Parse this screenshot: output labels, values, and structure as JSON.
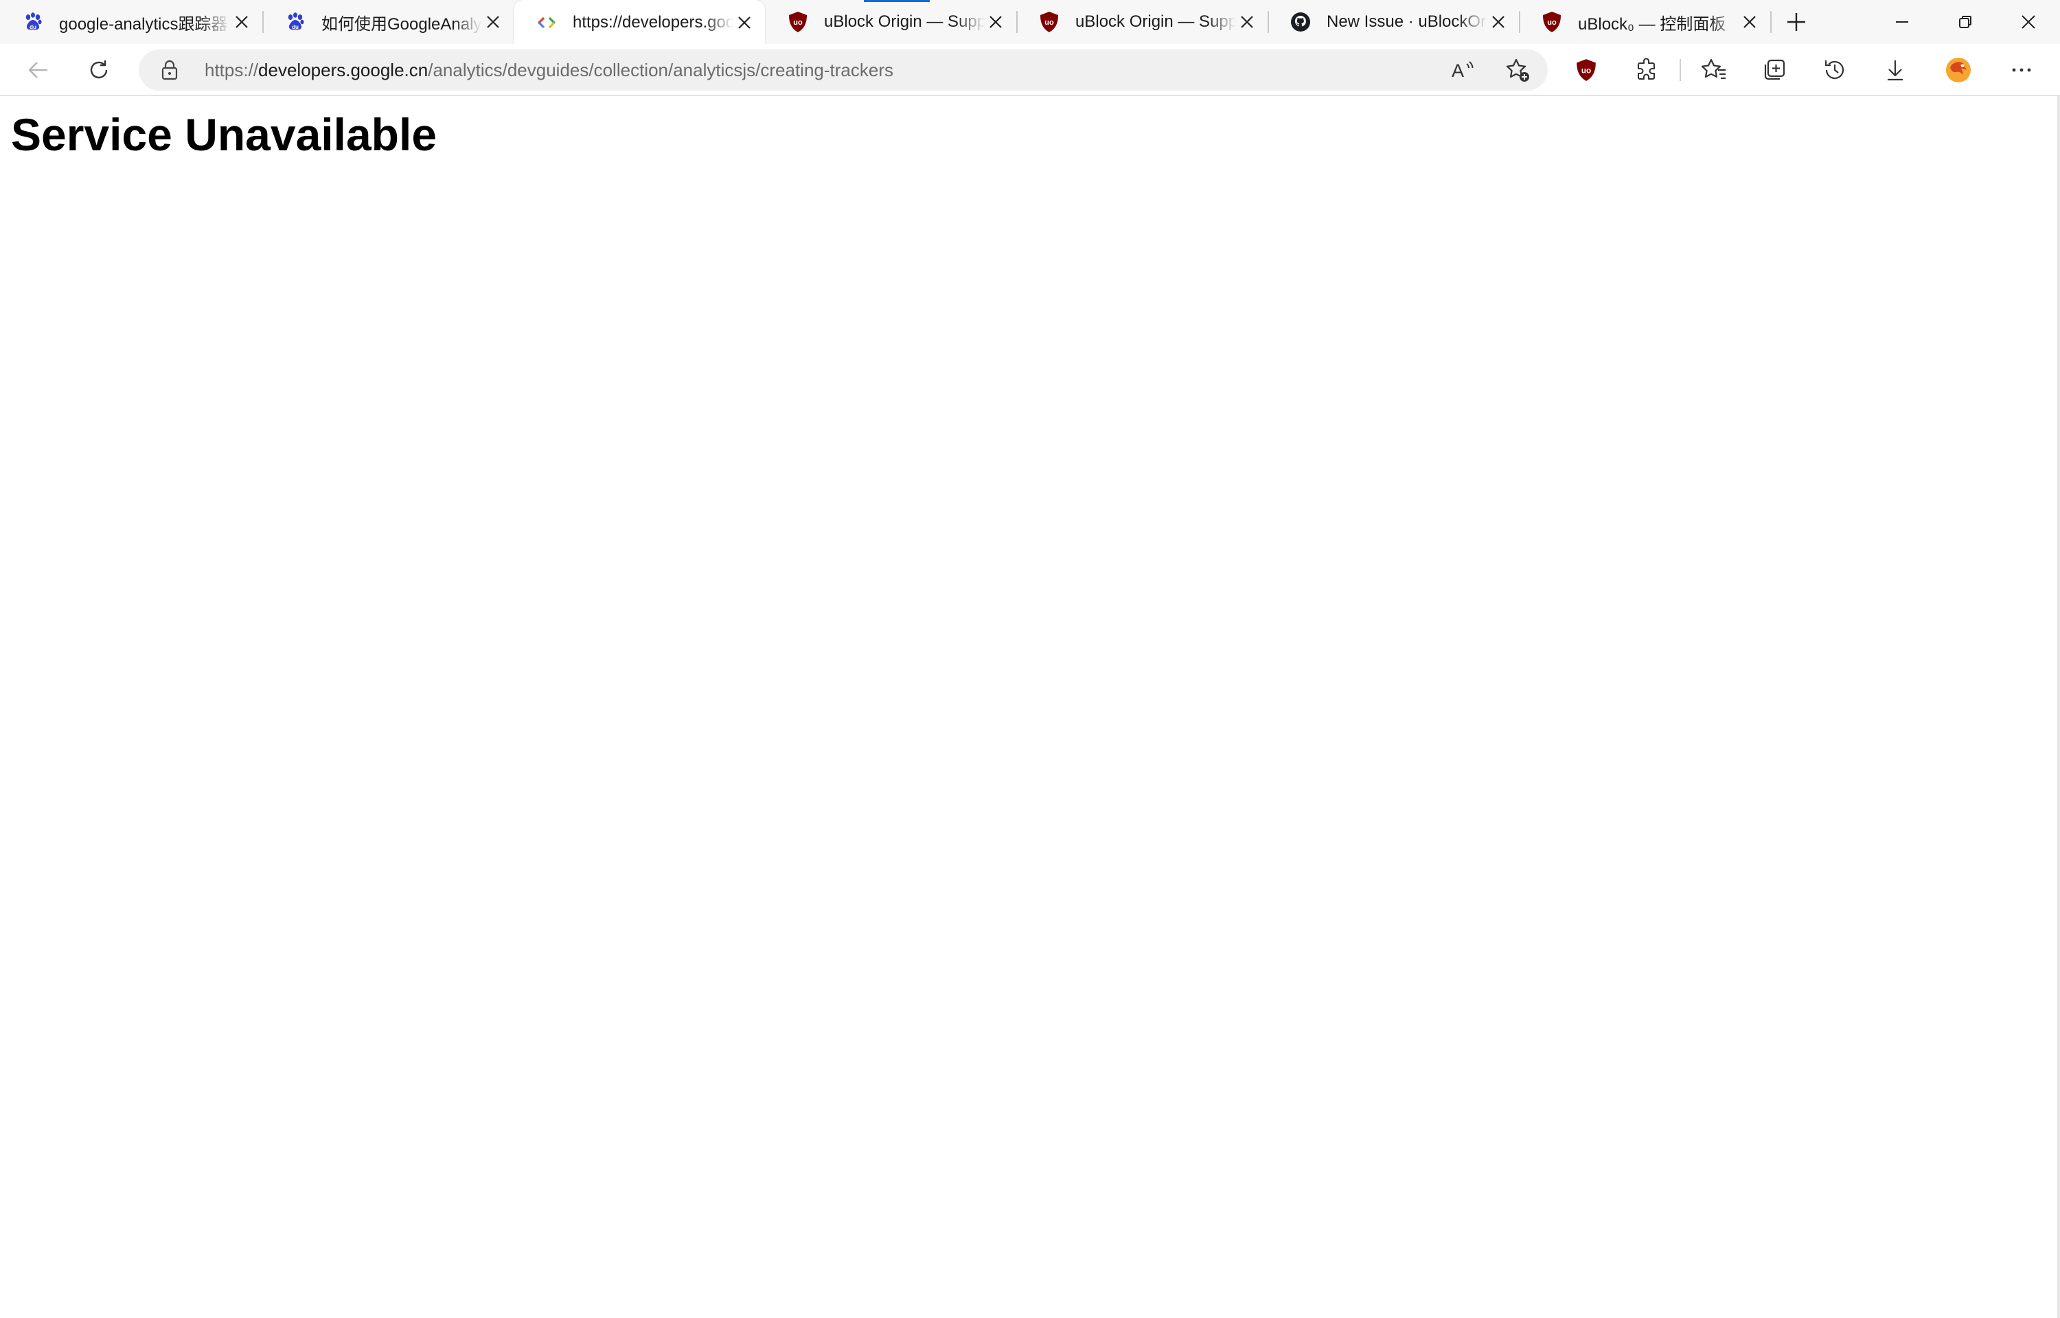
{
  "browser": {
    "tabs": [
      {
        "title": "google-analytics跟踪器",
        "favicon": "baidu-paw-icon",
        "active": false
      },
      {
        "title": "如何使用GoogleAnalytics",
        "favicon": "baidu-paw-icon",
        "active": false
      },
      {
        "title": "https://developers.google.cn",
        "favicon": "google-developers-icon",
        "active": true
      },
      {
        "title": "uBlock Origin — Support",
        "favicon": "ublock-origin-icon",
        "active": false
      },
      {
        "title": "uBlock Origin — Support",
        "favicon": "ublock-origin-icon",
        "active": false
      },
      {
        "title": "New Issue · uBlockOrigin",
        "favicon": "github-icon",
        "active": false
      },
      {
        "title": "uBlock₀ — 控制面板",
        "favicon": "ublock-origin-icon",
        "active": false
      }
    ],
    "address_bar": {
      "scheme": "https://",
      "host": "developers.google.cn",
      "path": "/analytics/devguides/collection/analyticsjs/creating-trackers"
    },
    "toolbar_icons": [
      "back-icon",
      "refresh-icon",
      "lock-icon",
      "read-aloud-icon",
      "add-favorite-icon",
      "ublock-origin-icon",
      "extensions-icon",
      "favorites-icon",
      "collections-icon",
      "history-icon",
      "downloads-icon",
      "profile-avatar-icon",
      "more-menu-icon"
    ],
    "window_controls": [
      "minimize-icon",
      "restore-icon",
      "close-icon"
    ],
    "colors": {
      "tabstrip_bg": "#f7f7f7",
      "address_bg": "#f0f0f0",
      "loading_accent": "#0a6cd6",
      "ublock_red": "#800000"
    }
  },
  "page": {
    "heading": "Service Unavailable"
  }
}
